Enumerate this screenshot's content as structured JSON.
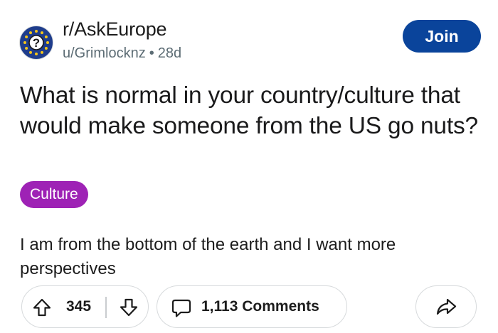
{
  "post": {
    "subreddit": "r/AskEurope",
    "author": "u/Grimlocknz",
    "separator": "•",
    "age": "28d",
    "join_label": "Join",
    "title": "What is normal in your country/culture that would make someone from the US go nuts?",
    "flair": "Culture",
    "body": "I am from the bottom of the earth and I want more perspectives"
  },
  "actions": {
    "score": "345",
    "comments_label": "1,113 Comments"
  },
  "icons": {
    "avatar": "eu-flag-question-icon",
    "upvote": "arrow-up-icon",
    "downvote": "arrow-down-icon",
    "comments": "comment-bubble-icon",
    "share": "share-arrow-icon"
  },
  "colors": {
    "join_button": "#0a449b",
    "flair_bg": "#9e22b5",
    "avatar_bg": "#1f3d8c",
    "avatar_stars": "#f5c518",
    "meta_text": "#5c6c74"
  }
}
